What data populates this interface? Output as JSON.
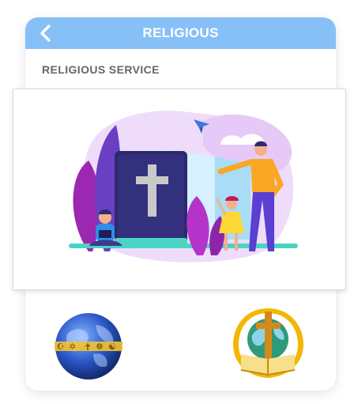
{
  "header": {
    "title": "RELIGIOUS",
    "back_icon": "chevron-left-icon"
  },
  "section": {
    "label": "RELIGIOUS SERVICE"
  },
  "hero": {
    "icon": "bible-family-illustration"
  },
  "tiles": [
    {
      "icon": "globe-interfaith-symbols-icon"
    },
    {
      "icon": "cross-bible-globe-emblem-icon"
    }
  ],
  "colors": {
    "header_bg": "#87c0f7",
    "header_text": "#ffffff",
    "label_text": "#666666"
  }
}
